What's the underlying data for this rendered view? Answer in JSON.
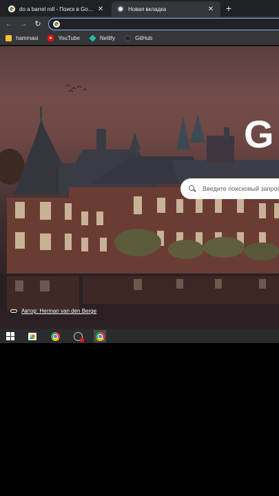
{
  "tabs": [
    {
      "title": "do a barrel roll - Поиск в Google",
      "close": "✕"
    },
    {
      "title": "Новая вкладка",
      "close": "✕"
    }
  ],
  "new_tab": "+",
  "toolbar": {
    "back": "←",
    "forward": "→",
    "reload": "↻"
  },
  "bookmarks": [
    {
      "label": "hammasi",
      "icon": "folder-icon"
    },
    {
      "label": "YouTube",
      "icon": "youtube-icon"
    },
    {
      "label": "Netlify",
      "icon": "netlify-icon"
    },
    {
      "label": "GitHub",
      "icon": "github-icon"
    }
  ],
  "page": {
    "logo": "G",
    "search_placeholder": "Введите поисковый запрос",
    "photo_credit": "Автор: Herman van den Berge"
  },
  "taskbar": [
    "windows-start-icon",
    "store-icon",
    "chrome-icon",
    "obs-icon",
    "chrome-active-icon"
  ],
  "colors": {
    "tab_bg": "#202124",
    "toolbar_bg": "#35363a",
    "omnibox_focus": "#8ab4f8"
  }
}
